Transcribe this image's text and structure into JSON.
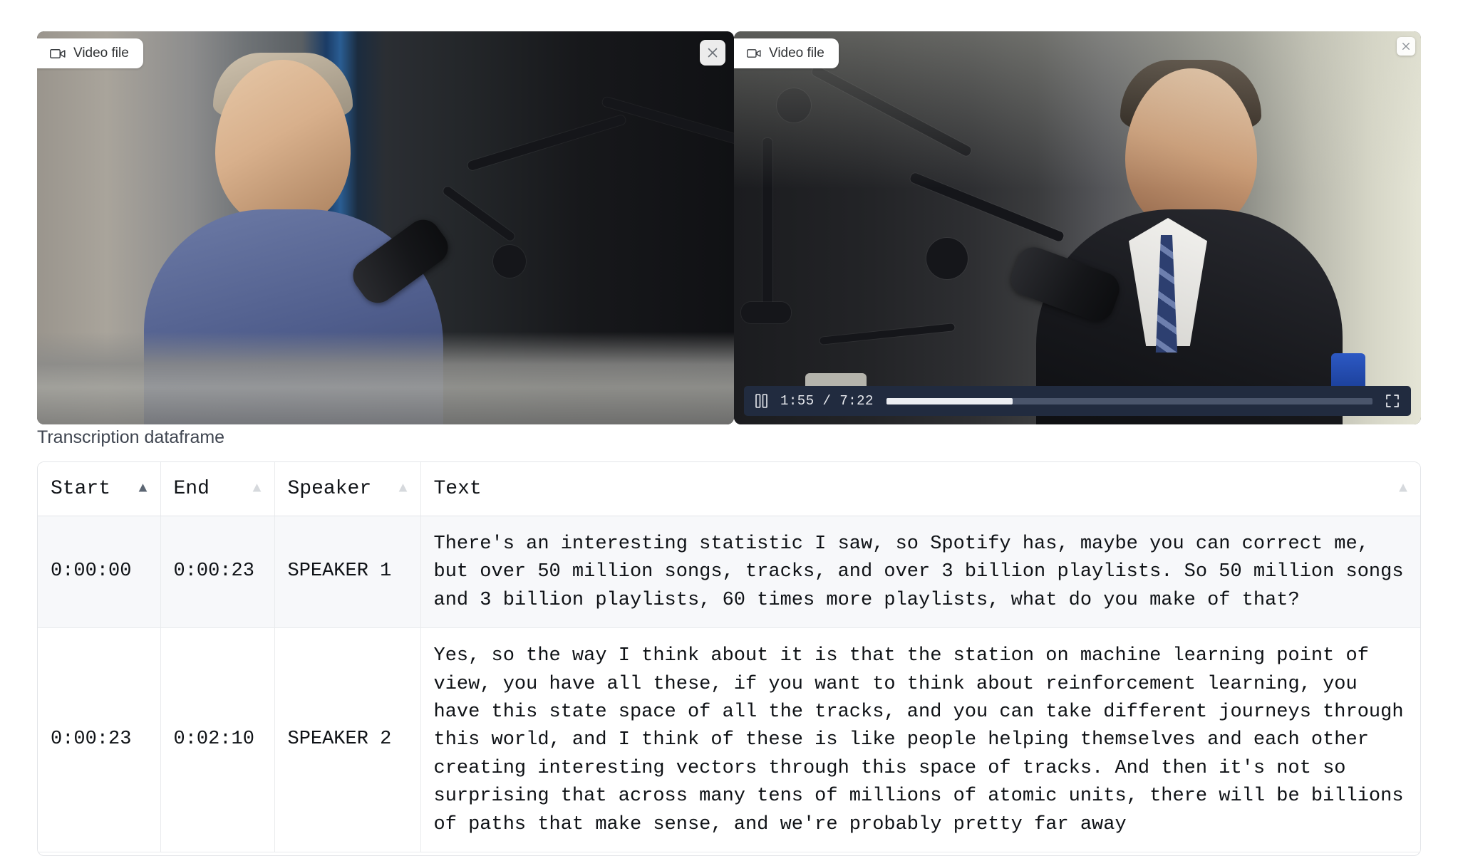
{
  "videos": [
    {
      "chip_label": "Video file",
      "chip_icon": "video-camera-icon",
      "close_icon": "close-icon",
      "has_controls": false
    },
    {
      "chip_label": "Video file",
      "chip_icon": "video-camera-icon",
      "close_icon": "close-icon",
      "has_controls": true,
      "controls": {
        "play_state": "pause-icon",
        "current_time": "1:55",
        "separator": "/",
        "duration": "7:22",
        "time_display": "1:55 / 7:22",
        "progress_percent": 26,
        "fullscreen_icon": "fullscreen-icon"
      }
    }
  ],
  "dataframe": {
    "label": "Transcription dataframe",
    "columns": [
      {
        "label": "Start",
        "sort_icon": "sort-ascending-icon",
        "sort_active": true
      },
      {
        "label": "End",
        "sort_icon": "sort-ascending-icon",
        "sort_active": false
      },
      {
        "label": "Speaker",
        "sort_icon": "sort-ascending-icon",
        "sort_active": false
      },
      {
        "label": "Text",
        "sort_icon": "sort-ascending-icon",
        "sort_active": false
      }
    ],
    "rows": [
      {
        "start": "0:00:00",
        "end": "0:00:23",
        "speaker": "SPEAKER 1",
        "text": "There's an interesting statistic I saw, so Spotify has, maybe you can correct me, but over 50 million songs, tracks, and over 3 billion playlists. So 50 million songs and 3 billion playlists, 60 times more playlists, what do you make of that?"
      },
      {
        "start": "0:00:23",
        "end": "0:02:10",
        "speaker": "SPEAKER 2",
        "text": "Yes, so the way I think about it is that the station on machine learning point of view, you have all these, if you want to think about reinforcement learning, you have this state space of all the tracks, and you can take different journeys through this world, and I think of these is like people helping themselves and each other creating interesting vectors through this space of tracks. And then it's not so surprising that across many tens of millions of atomic units, there will be billions of paths that make sense, and we're probably pretty far away"
      }
    ]
  },
  "colors": {
    "control_bar": "#212b3f",
    "progress_fill": "#eceef2",
    "progress_track": "#4a556b",
    "row_alt": "#f7f8fa",
    "border": "#e3e5e8",
    "label_text": "#3f4550"
  }
}
